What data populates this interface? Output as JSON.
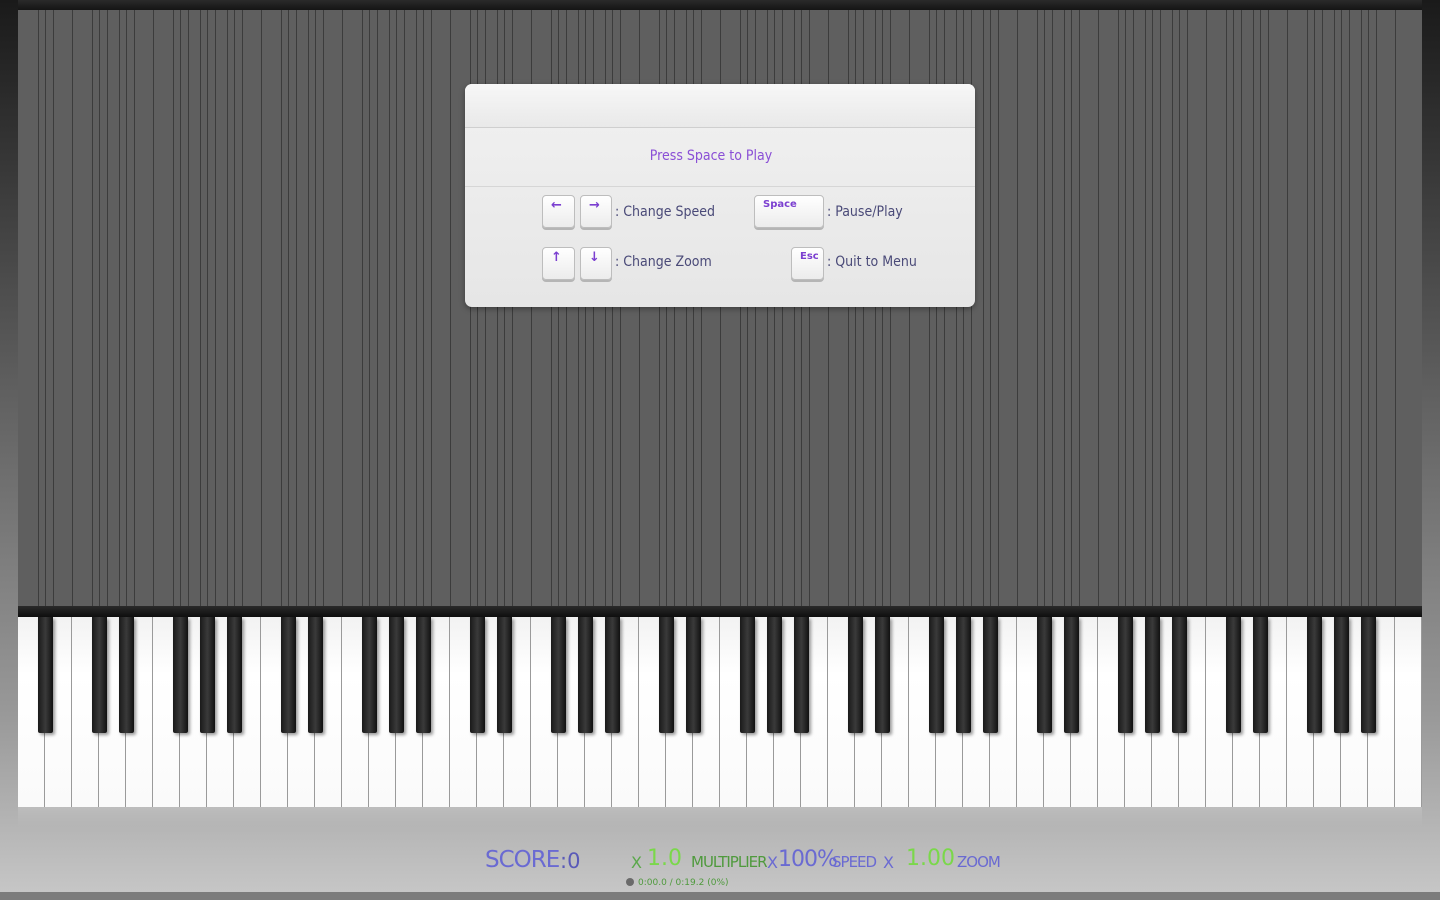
{
  "panel": {
    "prompt": "Press Space to Play",
    "shortcuts": [
      {
        "keys": [
          "←",
          "→"
        ],
        "label": ": Change Speed"
      },
      {
        "keys": [
          "Space"
        ],
        "label": ": Pause/Play"
      },
      {
        "keys": [
          "↑",
          "↓"
        ],
        "label": ": Change Zoom"
      },
      {
        "keys": [
          "Esc"
        ],
        "label": ": Quit to Menu"
      }
    ]
  },
  "status": {
    "score_label": "SCORE",
    "score_value": ":0",
    "multiplier_x": "X",
    "multiplier_value": "1.0",
    "multiplier_label": "MULTIPLIER",
    "speed_x": "X",
    "speed_value": "100%",
    "speed_label": "SPEED",
    "zoom_x": "X",
    "zoom_value": "1.00",
    "zoom_label": "ZOOM",
    "progress": "0:00.0 / 0:19.2 (0%)"
  },
  "colors": {
    "accent_purple": "#7b3fd0",
    "accent_green": "#7ad84a",
    "field_gray": "#5f5f5f"
  }
}
